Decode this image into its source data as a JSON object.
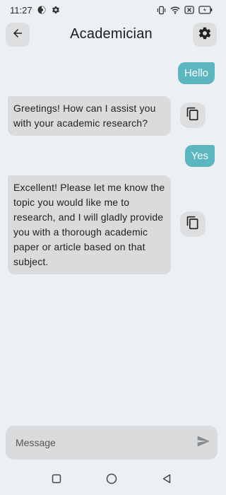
{
  "status_bar": {
    "time": "11:27",
    "icons": [
      "data-saver-icon",
      "settings-notification-icon",
      "vibrate-icon",
      "wifi-icon",
      "no-sim-icon",
      "battery-icon"
    ]
  },
  "app_bar": {
    "title": "Academician",
    "back_icon": "arrow-back-icon",
    "settings_icon": "gear-icon"
  },
  "messages": [
    {
      "role": "user",
      "text": "Hello"
    },
    {
      "role": "assistant",
      "text": "Greetings! How can I assist you with your academic research?"
    },
    {
      "role": "user",
      "text": "Yes"
    },
    {
      "role": "assistant",
      "text": "Excellent! Please let me know the topic you would like me to research, and I will gladly provide you with a thorough academic paper or article based on that subject."
    }
  ],
  "input": {
    "placeholder": "Message",
    "value": "",
    "send_icon": "send-icon"
  },
  "colors": {
    "background": "#edf0f2",
    "user_bubble": "#5bb6bf",
    "bot_bubble": "#d9dbdd"
  },
  "nav_bar": {
    "icons": [
      "recents-square-icon",
      "home-circle-icon",
      "back-triangle-icon"
    ]
  }
}
